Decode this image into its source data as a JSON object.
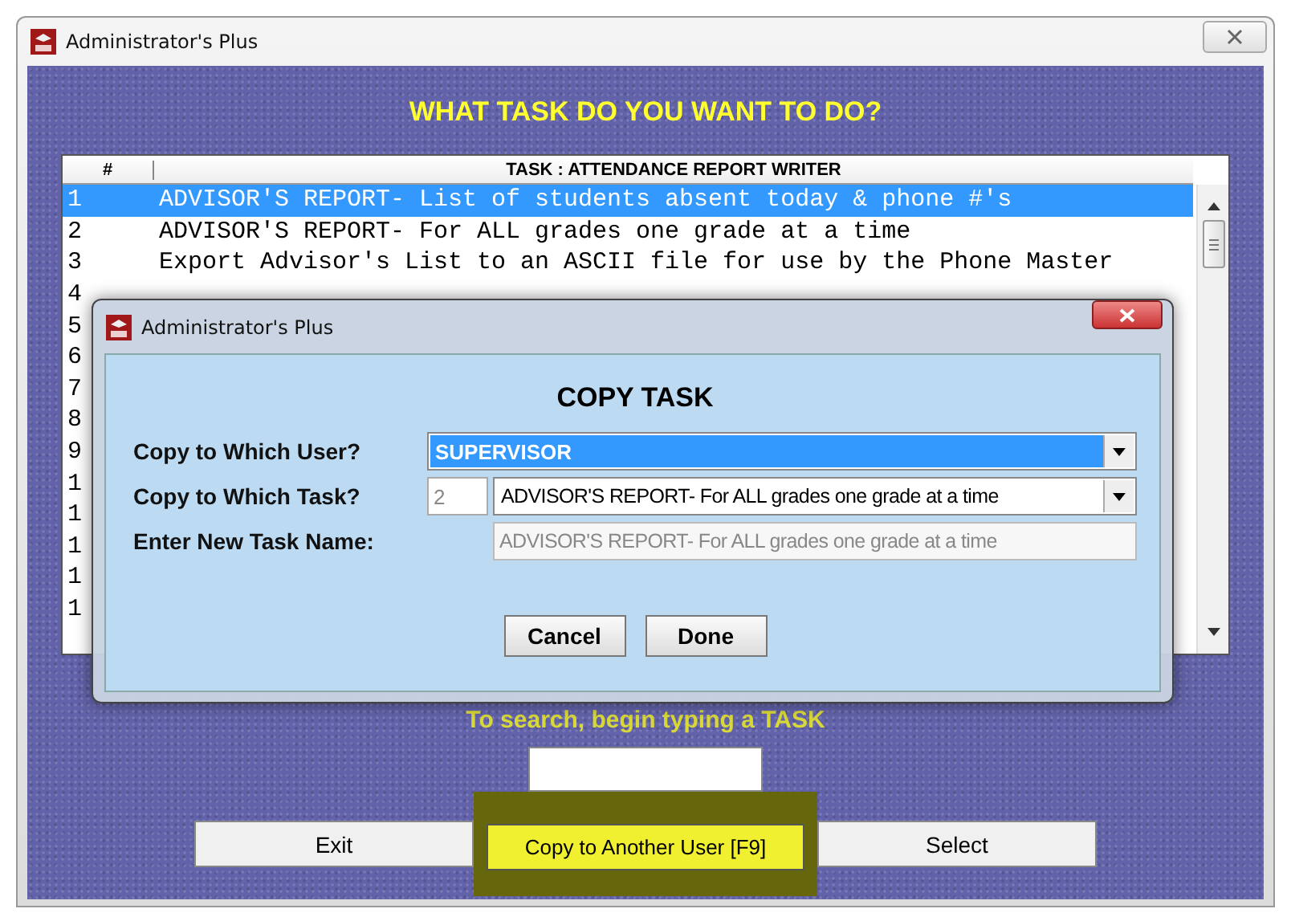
{
  "window": {
    "title": "Administrator's Plus"
  },
  "heading": "WHAT TASK DO YOU WANT TO DO?",
  "table": {
    "columns": [
      "#",
      "TASK : ATTENDANCE REPORT WRITER"
    ],
    "rows": [
      {
        "number": "1",
        "task": "ADVISOR'S REPORT- List of students absent today & phone #'s",
        "selected": true
      },
      {
        "number": "2",
        "task": "ADVISOR'S REPORT- For ALL grades one grade at a time",
        "selected": false
      },
      {
        "number": "3",
        "task": "Export Advisor's List to an ASCII file for use by the Phone Master",
        "selected": false
      },
      {
        "number": "4",
        "selected": false
      },
      {
        "number": "5",
        "selected": false
      },
      {
        "number": "6",
        "selected": false
      },
      {
        "number": "7",
        "selected": false
      },
      {
        "number": "8",
        "selected": false
      },
      {
        "number": "9",
        "selected": false
      },
      {
        "number": "1",
        "selected": false
      },
      {
        "number": "1",
        "selected": false
      },
      {
        "number": "1",
        "selected": false
      },
      {
        "number": "1",
        "selected": false
      },
      {
        "number": "1",
        "selected": false
      }
    ]
  },
  "dialog": {
    "title": "Administrator's Plus",
    "heading": "COPY TASK",
    "user": {
      "label": "Copy to Which User?",
      "value": "SUPERVISOR"
    },
    "task": {
      "label": "Copy to Which Task?",
      "number": "2",
      "value": "ADVISOR'S REPORT- For ALL grades one grade at a time"
    },
    "new_name": {
      "label": "Enter New Task Name:",
      "disabled": true,
      "value": "ADVISOR'S REPORT- For ALL grades one grade at a time"
    },
    "buttons": [
      "Cancel",
      "Done"
    ]
  },
  "search": {
    "label": "To search, begin typing a TASK"
  },
  "buttons": [
    {
      "label": "Exit",
      "highlighted": false
    },
    {
      "label": "Copy to Another User [F9]",
      "highlighted": true
    },
    {
      "label": "Select",
      "highlighted": false
    }
  ]
}
